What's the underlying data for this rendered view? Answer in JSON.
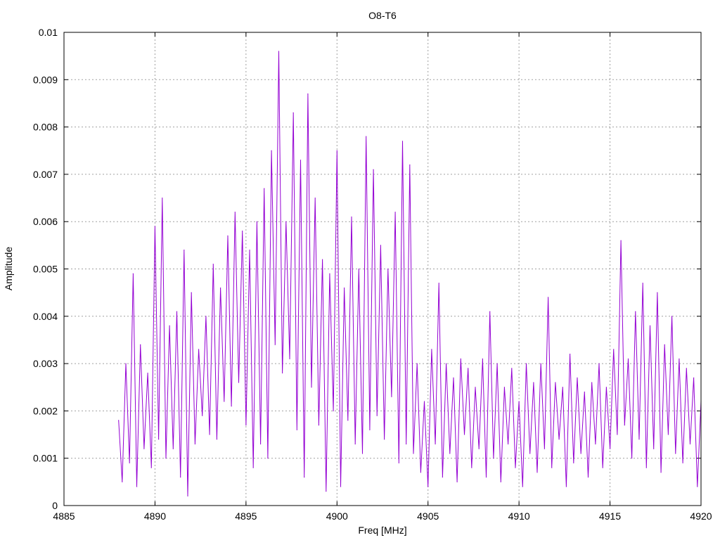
{
  "chart_data": {
    "type": "line",
    "title": "O8-T6",
    "xlabel": "Freq [MHz]",
    "ylabel": "Amplitude",
    "xlim": [
      4885,
      4920
    ],
    "ylim": [
      0,
      0.01
    ],
    "grid": true,
    "line_color": "#9400d3",
    "xticks": [
      "4885",
      "4890",
      "4895",
      "4900",
      "4905",
      "4910",
      "4915",
      "4920"
    ],
    "yticks": [
      "0",
      "0.001",
      "0.002",
      "0.003",
      "0.004",
      "0.005",
      "0.006",
      "0.007",
      "0.008",
      "0.009",
      "0.01"
    ],
    "x_start": 4888,
    "x_step": 0.2,
    "series": [
      {
        "name": "O8-T6",
        "values": [
          0.0018,
          0.0005,
          0.003,
          0.0009,
          0.0049,
          0.0004,
          0.0034,
          0.0012,
          0.0028,
          0.0008,
          0.0059,
          0.0014,
          0.0065,
          0.001,
          0.0038,
          0.0012,
          0.0041,
          0.0006,
          0.0054,
          0.0002,
          0.0045,
          0.0013,
          0.0033,
          0.0019,
          0.004,
          0.0015,
          0.0051,
          0.0014,
          0.0046,
          0.0022,
          0.0057,
          0.0021,
          0.0062,
          0.0026,
          0.0058,
          0.0017,
          0.0054,
          0.0008,
          0.006,
          0.0013,
          0.0067,
          0.001,
          0.0075,
          0.0034,
          0.0096,
          0.0028,
          0.006,
          0.0031,
          0.0083,
          0.0016,
          0.0073,
          0.0006,
          0.0087,
          0.0025,
          0.0065,
          0.0017,
          0.0052,
          0.0003,
          0.0049,
          0.002,
          0.0075,
          0.0004,
          0.0046,
          0.0018,
          0.0061,
          0.0013,
          0.005,
          0.0011,
          0.0078,
          0.0016,
          0.0071,
          0.0019,
          0.0055,
          0.0014,
          0.005,
          0.0023,
          0.0062,
          0.0009,
          0.0077,
          0.0013,
          0.0072,
          0.0011,
          0.003,
          0.0007,
          0.0022,
          0.0004,
          0.0033,
          0.0013,
          0.0047,
          0.0006,
          0.003,
          0.0011,
          0.0027,
          0.0005,
          0.0031,
          0.0015,
          0.0029,
          0.0008,
          0.0025,
          0.0012,
          0.0031,
          0.0006,
          0.0041,
          0.001,
          0.003,
          0.0005,
          0.0025,
          0.0013,
          0.0029,
          0.0008,
          0.0022,
          0.0004,
          0.003,
          0.0011,
          0.0026,
          0.0007,
          0.003,
          0.0012,
          0.0044,
          0.0008,
          0.0026,
          0.0014,
          0.0025,
          0.0004,
          0.0032,
          0.0009,
          0.0027,
          0.0011,
          0.0024,
          0.0006,
          0.0026,
          0.0013,
          0.003,
          0.0008,
          0.0025,
          0.0012,
          0.0033,
          0.0015,
          0.0056,
          0.0017,
          0.0031,
          0.001,
          0.0041,
          0.0014,
          0.0047,
          0.0008,
          0.0038,
          0.0012,
          0.0045,
          0.0007,
          0.0034,
          0.0015,
          0.004,
          0.0011,
          0.0031,
          0.0009,
          0.0029,
          0.0013,
          0.0027,
          0.0004,
          0.0022
        ]
      }
    ]
  }
}
